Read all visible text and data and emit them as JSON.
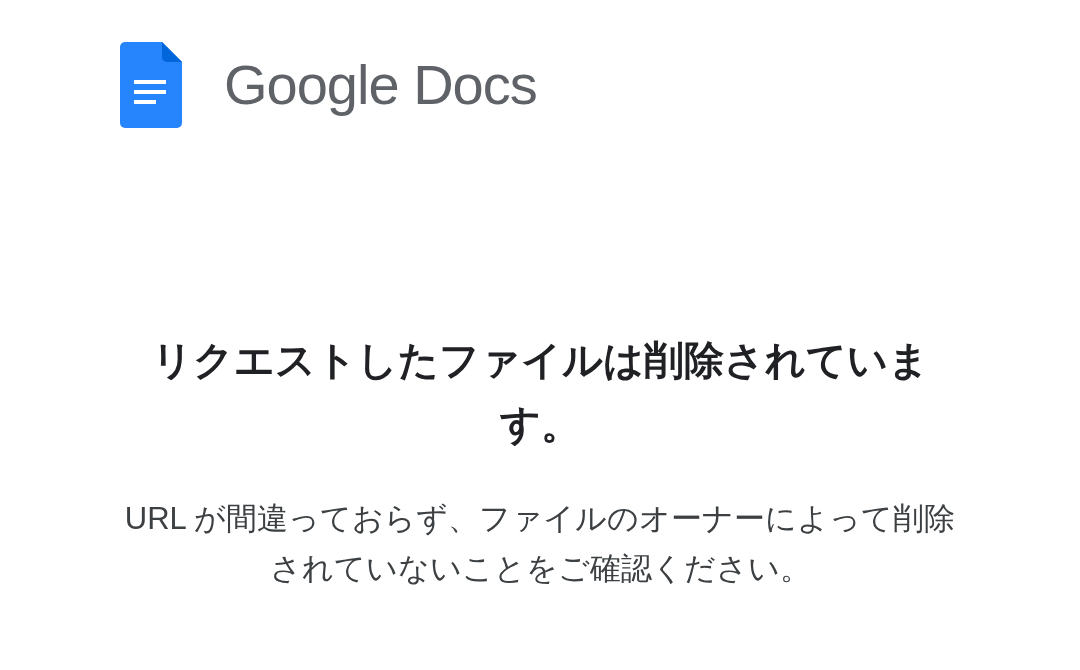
{
  "header": {
    "logo_text": "Google Docs"
  },
  "message": {
    "title": "リクエストしたファイルは削除されています。",
    "body": "URL が間違っておらず、ファイルのオーナーによって削除されていないことをご確認ください。"
  }
}
